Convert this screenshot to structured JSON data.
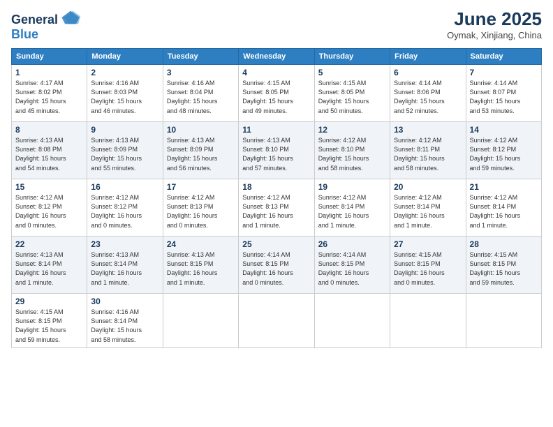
{
  "header": {
    "logo_line1": "General",
    "logo_line2": "Blue",
    "month_year": "June 2025",
    "location": "Oymak, Xinjiang, China"
  },
  "weekdays": [
    "Sunday",
    "Monday",
    "Tuesday",
    "Wednesday",
    "Thursday",
    "Friday",
    "Saturday"
  ],
  "weeks": [
    [
      {
        "day": "1",
        "detail": "Sunrise: 4:17 AM\nSunset: 8:02 PM\nDaylight: 15 hours\nand 45 minutes."
      },
      {
        "day": "2",
        "detail": "Sunrise: 4:16 AM\nSunset: 8:03 PM\nDaylight: 15 hours\nand 46 minutes."
      },
      {
        "day": "3",
        "detail": "Sunrise: 4:16 AM\nSunset: 8:04 PM\nDaylight: 15 hours\nand 48 minutes."
      },
      {
        "day": "4",
        "detail": "Sunrise: 4:15 AM\nSunset: 8:05 PM\nDaylight: 15 hours\nand 49 minutes."
      },
      {
        "day": "5",
        "detail": "Sunrise: 4:15 AM\nSunset: 8:05 PM\nDaylight: 15 hours\nand 50 minutes."
      },
      {
        "day": "6",
        "detail": "Sunrise: 4:14 AM\nSunset: 8:06 PM\nDaylight: 15 hours\nand 52 minutes."
      },
      {
        "day": "7",
        "detail": "Sunrise: 4:14 AM\nSunset: 8:07 PM\nDaylight: 15 hours\nand 53 minutes."
      }
    ],
    [
      {
        "day": "8",
        "detail": "Sunrise: 4:13 AM\nSunset: 8:08 PM\nDaylight: 15 hours\nand 54 minutes."
      },
      {
        "day": "9",
        "detail": "Sunrise: 4:13 AM\nSunset: 8:09 PM\nDaylight: 15 hours\nand 55 minutes."
      },
      {
        "day": "10",
        "detail": "Sunrise: 4:13 AM\nSunset: 8:09 PM\nDaylight: 15 hours\nand 56 minutes."
      },
      {
        "day": "11",
        "detail": "Sunrise: 4:13 AM\nSunset: 8:10 PM\nDaylight: 15 hours\nand 57 minutes."
      },
      {
        "day": "12",
        "detail": "Sunrise: 4:12 AM\nSunset: 8:10 PM\nDaylight: 15 hours\nand 58 minutes."
      },
      {
        "day": "13",
        "detail": "Sunrise: 4:12 AM\nSunset: 8:11 PM\nDaylight: 15 hours\nand 58 minutes."
      },
      {
        "day": "14",
        "detail": "Sunrise: 4:12 AM\nSunset: 8:12 PM\nDaylight: 15 hours\nand 59 minutes."
      }
    ],
    [
      {
        "day": "15",
        "detail": "Sunrise: 4:12 AM\nSunset: 8:12 PM\nDaylight: 16 hours\nand 0 minutes."
      },
      {
        "day": "16",
        "detail": "Sunrise: 4:12 AM\nSunset: 8:12 PM\nDaylight: 16 hours\nand 0 minutes."
      },
      {
        "day": "17",
        "detail": "Sunrise: 4:12 AM\nSunset: 8:13 PM\nDaylight: 16 hours\nand 0 minutes."
      },
      {
        "day": "18",
        "detail": "Sunrise: 4:12 AM\nSunset: 8:13 PM\nDaylight: 16 hours\nand 1 minute."
      },
      {
        "day": "19",
        "detail": "Sunrise: 4:12 AM\nSunset: 8:14 PM\nDaylight: 16 hours\nand 1 minute."
      },
      {
        "day": "20",
        "detail": "Sunrise: 4:12 AM\nSunset: 8:14 PM\nDaylight: 16 hours\nand 1 minute."
      },
      {
        "day": "21",
        "detail": "Sunrise: 4:12 AM\nSunset: 8:14 PM\nDaylight: 16 hours\nand 1 minute."
      }
    ],
    [
      {
        "day": "22",
        "detail": "Sunrise: 4:13 AM\nSunset: 8:14 PM\nDaylight: 16 hours\nand 1 minute."
      },
      {
        "day": "23",
        "detail": "Sunrise: 4:13 AM\nSunset: 8:14 PM\nDaylight: 16 hours\nand 1 minute."
      },
      {
        "day": "24",
        "detail": "Sunrise: 4:13 AM\nSunset: 8:15 PM\nDaylight: 16 hours\nand 1 minute."
      },
      {
        "day": "25",
        "detail": "Sunrise: 4:14 AM\nSunset: 8:15 PM\nDaylight: 16 hours\nand 0 minutes."
      },
      {
        "day": "26",
        "detail": "Sunrise: 4:14 AM\nSunset: 8:15 PM\nDaylight: 16 hours\nand 0 minutes."
      },
      {
        "day": "27",
        "detail": "Sunrise: 4:15 AM\nSunset: 8:15 PM\nDaylight: 16 hours\nand 0 minutes."
      },
      {
        "day": "28",
        "detail": "Sunrise: 4:15 AM\nSunset: 8:15 PM\nDaylight: 15 hours\nand 59 minutes."
      }
    ],
    [
      {
        "day": "29",
        "detail": "Sunrise: 4:15 AM\nSunset: 8:15 PM\nDaylight: 15 hours\nand 59 minutes."
      },
      {
        "day": "30",
        "detail": "Sunrise: 4:16 AM\nSunset: 8:14 PM\nDaylight: 15 hours\nand 58 minutes."
      },
      null,
      null,
      null,
      null,
      null
    ]
  ]
}
